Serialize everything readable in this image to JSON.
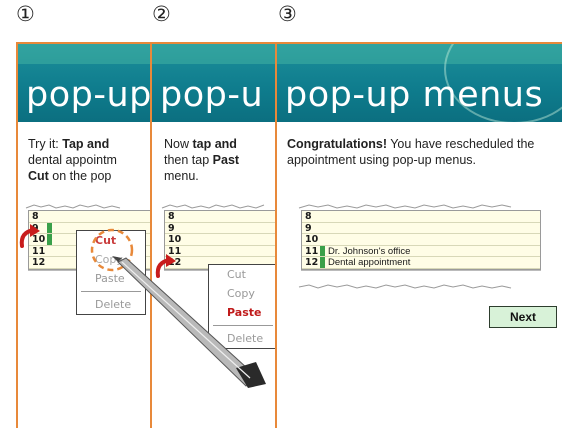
{
  "steps": [
    "①",
    "②",
    "③"
  ],
  "header_title": "pop-up menus",
  "panel1": {
    "title_visible": "pop-up",
    "instruction": {
      "prefix": "Try it: ",
      "bold": "Tap and",
      "line2": "dental appointm",
      "line3_bold": "Cut",
      "line3_rest": " on the pop"
    },
    "hours": [
      "8",
      "9",
      "10",
      "11",
      "12"
    ],
    "popup": [
      "Cut",
      "Copy",
      "Paste",
      "Delete"
    ]
  },
  "panel2": {
    "title_visible": "pop-u",
    "instruction": {
      "prefix": "Now ",
      "bold": "tap and",
      "line2_prefix": "then tap ",
      "line2_bold": "Past",
      "line3": "menu."
    },
    "hours": [
      "8",
      "9",
      "10",
      "11",
      "12"
    ],
    "popup": [
      "Cut",
      "Copy",
      "Paste",
      "Delete"
    ]
  },
  "panel3": {
    "instruction": {
      "bold": "Congratulations!",
      "rest": " You have rescheduled the appointment using pop-up menus."
    },
    "hours": [
      "8",
      "9",
      "10",
      "11",
      "12"
    ],
    "appointment": {
      "line1": "Dr. Johnson's office",
      "line2": "Dental appointment"
    },
    "next_label": "Next"
  },
  "colors": {
    "accent": "#e8893a",
    "header": "#0f7d8e",
    "highlight": "#c01a1a",
    "appt": "#3aa04a",
    "next_bg": "#d8f2d8"
  }
}
